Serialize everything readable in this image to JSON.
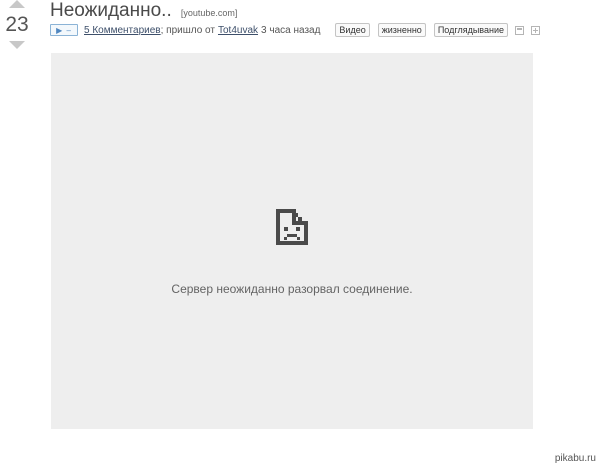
{
  "rating": {
    "value": "23"
  },
  "post": {
    "title": "Неожиданно..",
    "domain": "[youtube.com]",
    "play_toggle": "▶ –",
    "comments_link": "5 Комментариев",
    "posted_from_text": "; пришло от",
    "author": "Tot4uvak",
    "time_ago": "3 часа назад",
    "tags": [
      "Видео",
      "жизненно",
      "Подглядывание"
    ]
  },
  "video": {
    "error_message": "Сервер неожиданно разорвал соединение."
  },
  "watermark": {
    "text": "pikabu.ru"
  },
  "icons": {
    "upvote": "triangle-up-icon",
    "downvote": "triangle-down-icon",
    "save": "save-icon",
    "add": "plus-icon",
    "broken_file": "broken-file-sad-icon"
  }
}
